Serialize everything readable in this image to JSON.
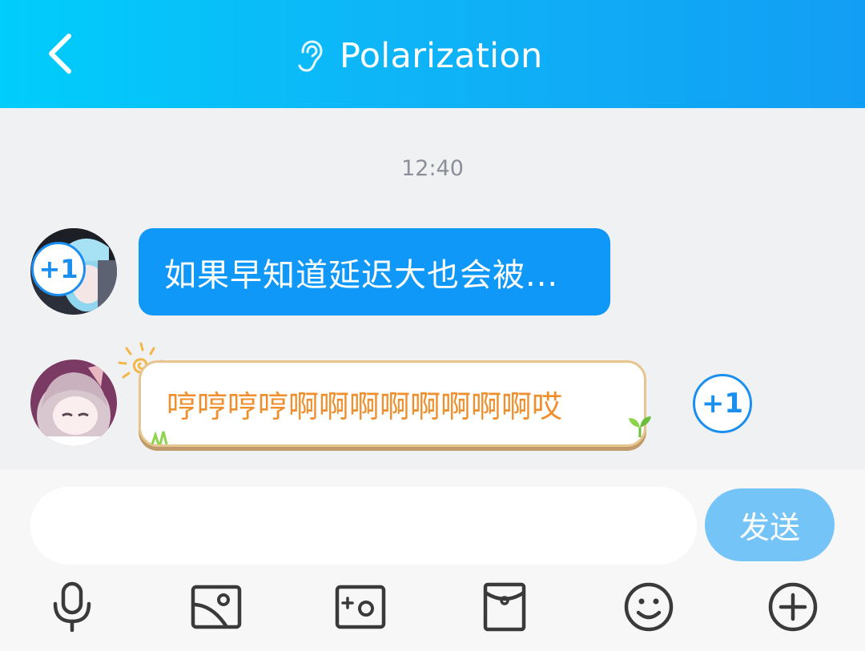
{
  "header": {
    "title": "Polarization",
    "back_icon": "chevron-left-icon",
    "title_icon": "ear-icon",
    "gradient_start": "#00cdfb",
    "gradient_end": "#129ef4"
  },
  "chat": {
    "timestamp": "12:40",
    "messages": [
      {
        "sender": "other",
        "text": "如果早知道延迟大也会被...",
        "bubble_color": "#0f98f8",
        "plus_one_label": "+1"
      },
      {
        "sender": "other",
        "text": "哼哼哼哼啊啊啊啊啊啊啊啊哎",
        "text_color": "#ef8e2a",
        "plus_one_label": "+1"
      }
    ]
  },
  "composer": {
    "input_value": "",
    "send_label": "发送",
    "send_color": "#75c4f8"
  },
  "toolbar": {
    "items": [
      {
        "icon": "microphone-icon"
      },
      {
        "icon": "image-icon"
      },
      {
        "icon": "camera-icon"
      },
      {
        "icon": "red-packet-icon"
      },
      {
        "icon": "emoji-icon"
      },
      {
        "icon": "plus-circle-icon"
      }
    ]
  }
}
